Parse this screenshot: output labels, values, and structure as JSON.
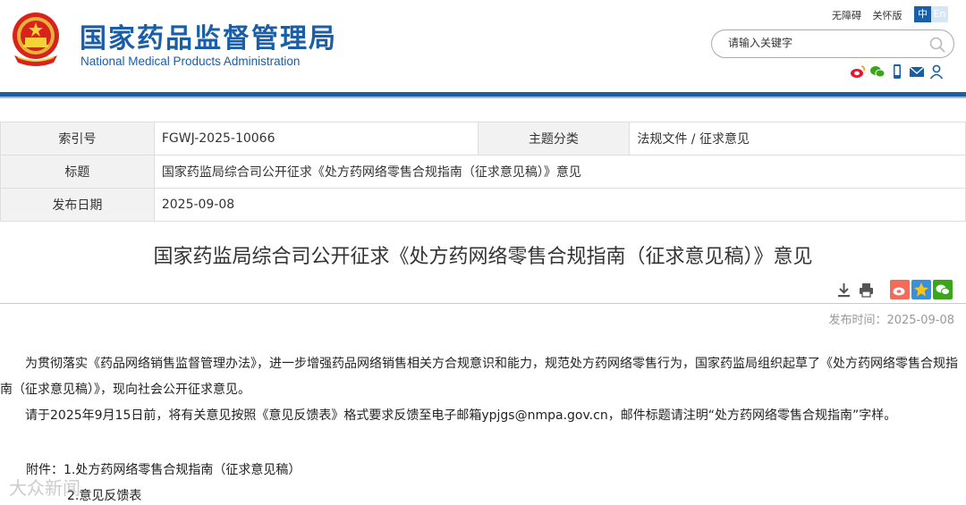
{
  "header": {
    "title_cn": "国家药品监督管理局",
    "title_en": "National Medical Products Administration",
    "top_links": [
      "无障碍",
      "关怀版"
    ],
    "lang": {
      "zh": "中",
      "en": "En"
    },
    "search_placeholder": "请输入关键字",
    "share_icons": [
      "weibo-icon",
      "wechat-icon",
      "mobile-icon",
      "mail-icon",
      "user-icon"
    ]
  },
  "info_table": {
    "index_label": "索引号",
    "index_value": "FGWJ-2025-10066",
    "topic_label": "主题分类",
    "topic_value": "法规文件 / 征求意见",
    "title_label": "标题",
    "title_value": "国家药监局综合司公开征求《处方药网络零售合规指南（征求意见稿）》意见",
    "date_label": "发布日期",
    "date_value": "2025-09-08"
  },
  "article": {
    "title": "国家药监局综合司公开征求《处方药网络零售合规指南（征求意见稿）》意见",
    "tools": [
      "download-icon",
      "print-icon"
    ],
    "share": [
      "weibo-icon",
      "qzone-icon",
      "wechat-icon"
    ],
    "publish_time": "发布时间：2025-09-08",
    "paragraphs": [
      "为贯彻落实《药品网络销售监督管理办法》，进一步增强药品网络销售相关方合规意识和能力，规范处方药网络零售行为，国家药监局组织起草了《处方药网络零售合规指南（征求意见稿）》，现向社会公开征求意见。",
      "请于2025年9月15日前，将有关意见按照《意见反馈表》格式要求反馈至电子邮箱ypjgs@nmpa.gov.cn，邮件标题请注明“处方药网络零售合规指南”字样。"
    ],
    "attachments_label": "附件：",
    "attachments": [
      "1.处方药网络零售合规指南（征求意见稿）",
      "2.意见反馈表"
    ]
  },
  "watermark": "大众新闻"
}
